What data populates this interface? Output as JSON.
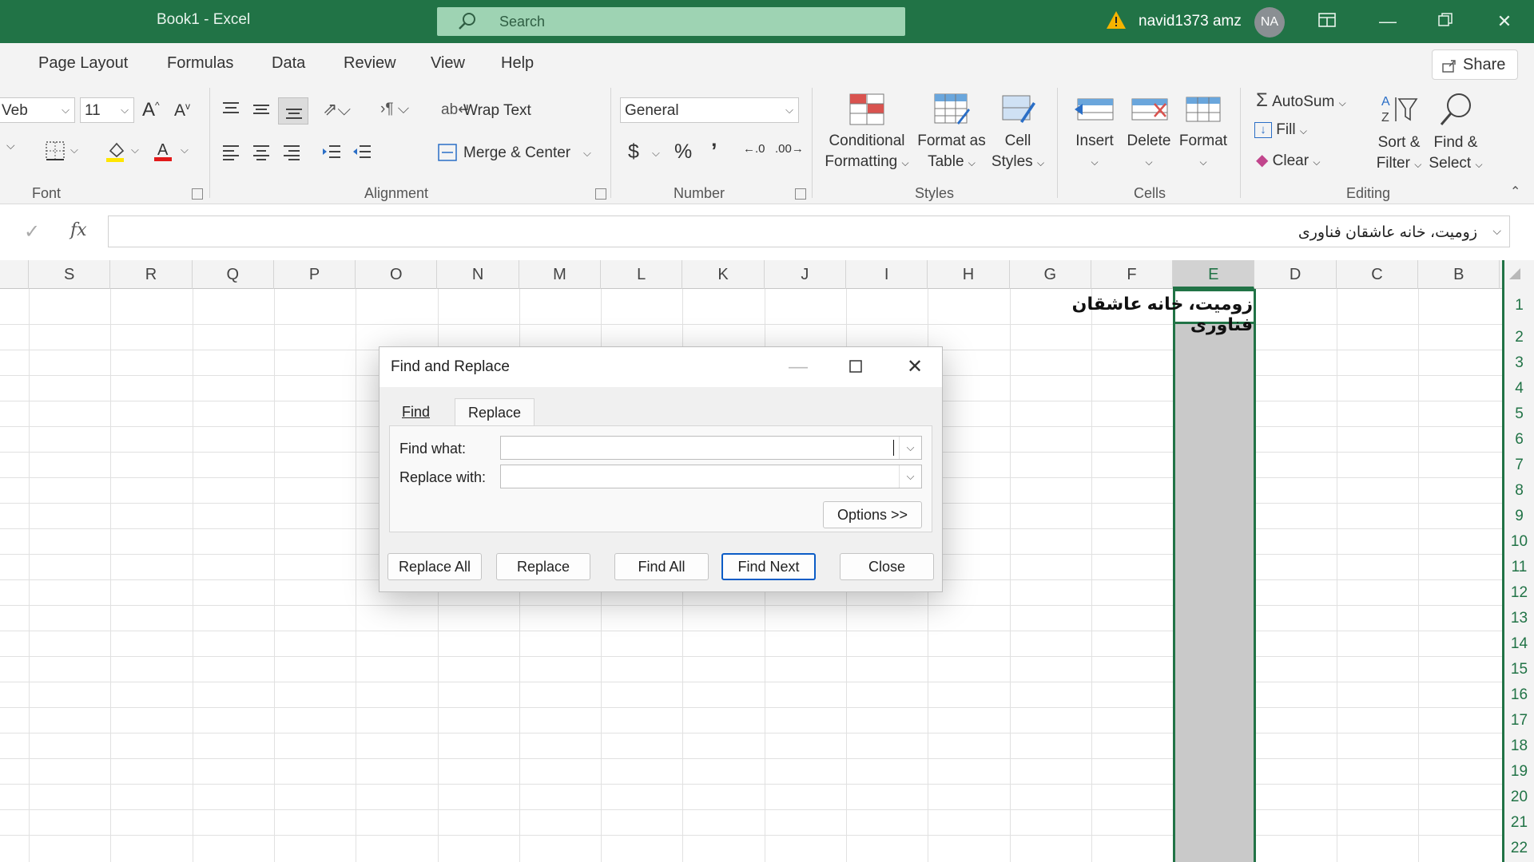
{
  "window": {
    "title": "Book1  -  Excel",
    "search_placeholder": "Search",
    "user": "navid1373 amz",
    "avatar": "NA",
    "theme_color": "#217346"
  },
  "menu_tabs": [
    "Page Layout",
    "Formulas",
    "Data",
    "Review",
    "View",
    "Help"
  ],
  "share_label": "Share",
  "ribbon": {
    "font": {
      "name": "Veb",
      "size": "11",
      "group": "Font"
    },
    "alignment": {
      "wrap_text": "Wrap Text",
      "merge_center": "Merge & Center",
      "group": "Alignment"
    },
    "number": {
      "format": "General",
      "group": "Number"
    },
    "styles": {
      "conditional": [
        "Conditional",
        "Formatting"
      ],
      "format_table": [
        "Format as",
        "Table"
      ],
      "cell_styles": [
        "Cell",
        "Styles"
      ],
      "group": "Styles"
    },
    "cells": {
      "insert": "Insert",
      "delete": "Delete",
      "format": "Format",
      "group": "Cells"
    },
    "editing": {
      "autosum": "AutoSum",
      "fill": "Fill",
      "clear": "Clear",
      "sort_filter": [
        "Sort &",
        "Filter"
      ],
      "find_select": [
        "Find &",
        "Select"
      ],
      "group": "Editing"
    }
  },
  "formula_bar": {
    "fx": "fx",
    "content": "زومیت، خانه عاشقان فناوری"
  },
  "columns": [
    "S",
    "R",
    "Q",
    "P",
    "O",
    "N",
    "M",
    "L",
    "K",
    "J",
    "I",
    "H",
    "G",
    "F",
    "E",
    "D",
    "C",
    "B"
  ],
  "active_column": "E",
  "rows": [
    "1",
    "2",
    "3",
    "4",
    "5",
    "6",
    "7",
    "8",
    "9",
    "10",
    "11",
    "12",
    "13",
    "14",
    "15",
    "16",
    "17",
    "18",
    "19",
    "20",
    "21",
    "22"
  ],
  "cell_E1": "زومیت، خانه عاشقان فناوری",
  "dialog": {
    "title": "Find and Replace",
    "tabs": [
      "Find",
      "Replace"
    ],
    "active_tab": "Replace",
    "find_what_label": "Find what:",
    "find_what_value": "",
    "replace_with_label": "Replace with:",
    "replace_with_value": "",
    "options": "Options >>",
    "buttons": {
      "replace_all": "Replace All",
      "replace": "Replace",
      "find_all": "Find All",
      "find_next": "Find Next",
      "close": "Close"
    }
  }
}
